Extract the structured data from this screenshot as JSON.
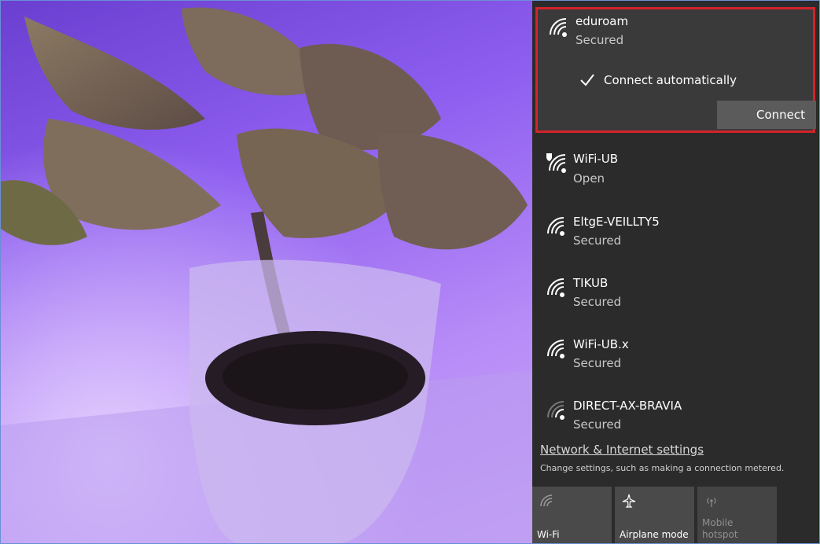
{
  "selected_network": {
    "name": "eduroam",
    "status": "Secured",
    "connect_automatically_label": "Connect automatically",
    "connect_automatically_checked": true,
    "connect_label": "Connect"
  },
  "networks": [
    {
      "name": "WiFi-UB",
      "status": "Open",
      "icon": "wifi-open-shield-icon"
    },
    {
      "name": "EltgE-VEILLTY5",
      "status": "Secured",
      "icon": "wifi-secured-icon"
    },
    {
      "name": "TIKUB",
      "status": "Secured",
      "icon": "wifi-secured-icon"
    },
    {
      "name": "WiFi-UB.x",
      "status": "Secured",
      "icon": "wifi-secured-icon"
    },
    {
      "name": "DIRECT-AX-BRAVIA",
      "status": "Secured",
      "icon": "wifi-weak-icon"
    }
  ],
  "settings": {
    "link_label": "Network & Internet settings",
    "description": "Change settings, such as making a connection metered."
  },
  "quick_actions": [
    {
      "label": "Wi-Fi",
      "icon": "wifi-icon",
      "enabled": true
    },
    {
      "label": "Airplane mode",
      "icon": "airplane-icon",
      "enabled": true
    },
    {
      "label": "Mobile hotspot",
      "icon": "hotspot-icon",
      "enabled": false
    }
  ],
  "colors": {
    "flyout_bg": "#2b2b2b",
    "highlight_border": "#d3232b",
    "button_bg": "#5b5b5b"
  }
}
